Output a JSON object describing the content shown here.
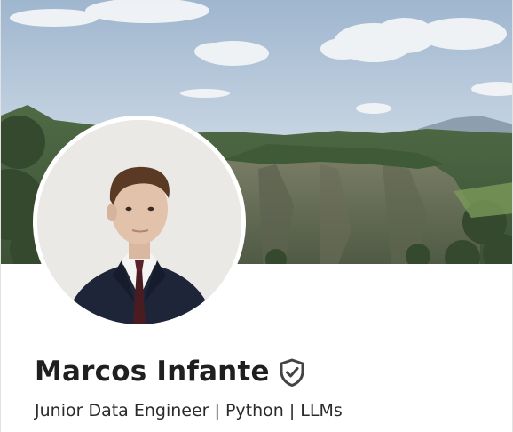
{
  "profile": {
    "name": "Marcos Infante",
    "headline": "Junior Data Engineer | Python | LLMs"
  },
  "icons": {
    "verified": "shield-check-icon"
  },
  "colors": {
    "text_primary": "#1f1f1f",
    "text_secondary": "#2a2a2a",
    "card_bg": "#ffffff"
  }
}
